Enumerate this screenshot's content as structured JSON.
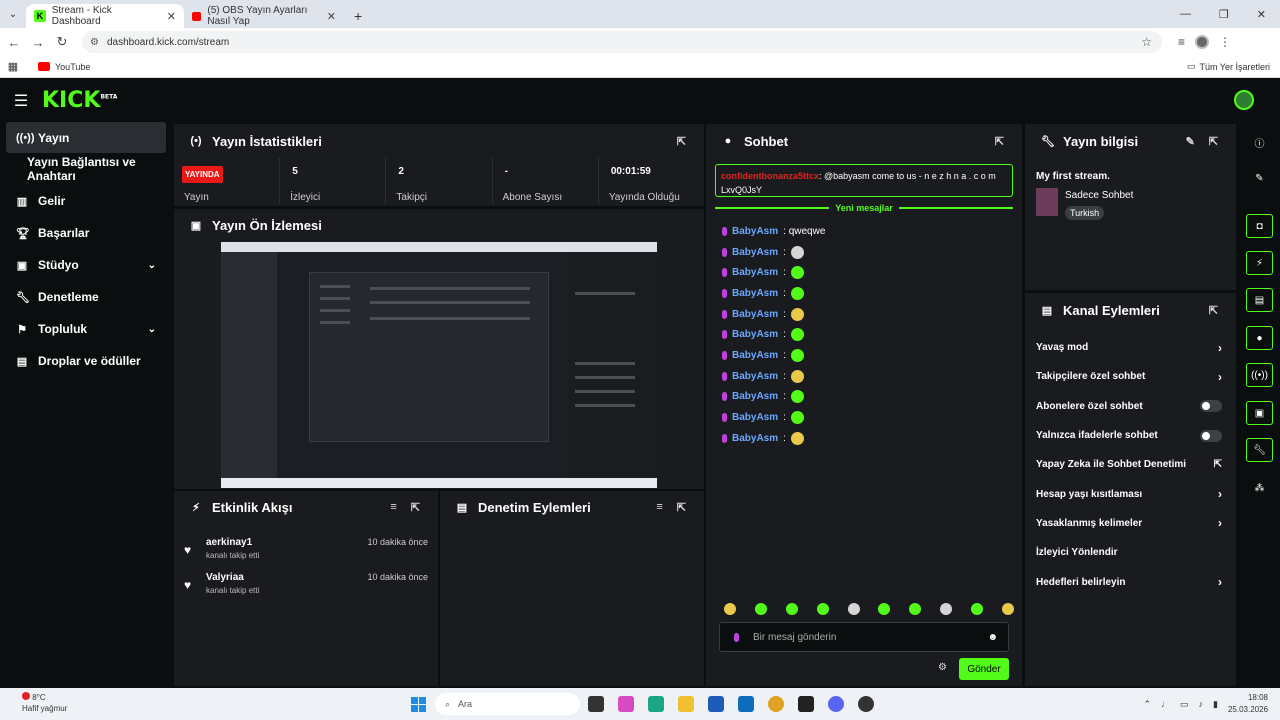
{
  "browser": {
    "tabs": [
      {
        "title": "Stream - Kick Dashboard",
        "active": true
      },
      {
        "title": "(5) OBS Yayın Ayarları Nasıl Yap",
        "active": false
      }
    ],
    "url": "dashboard.kick.com/stream",
    "bookmarks": [
      {
        "label": "YouTube"
      }
    ],
    "all_bookmarks": "Tüm Yer İşaretleri"
  },
  "header": {
    "logo": "KICK",
    "logo_sup": "BETA"
  },
  "sidebar": {
    "items": [
      {
        "label": "Yayın",
        "icon": "stream-icon"
      },
      {
        "label": "Yayın Bağlantısı ve Anahtarı",
        "icon": ""
      },
      {
        "label": "Gelir",
        "icon": "chart-icon"
      },
      {
        "label": "Başarılar",
        "icon": "trophy-icon"
      },
      {
        "label": "Stüdyo",
        "icon": "studio-icon"
      },
      {
        "label": "Denetleme",
        "icon": "wrench-icon"
      },
      {
        "label": "Topluluk",
        "icon": "community-icon"
      },
      {
        "label": "Droplar ve ödüller",
        "icon": "gift-icon"
      }
    ]
  },
  "stats": {
    "title": "Yayın İstatistikleri",
    "live_badge": "YAYINDA",
    "items": [
      {
        "value": "",
        "label": "Yayın"
      },
      {
        "value": "5",
        "label": "İzleyici"
      },
      {
        "value": "2",
        "label": "Takipçi"
      },
      {
        "value": "-",
        "label": "Abone Sayısı"
      },
      {
        "value": "00:01:59",
        "label": "Yayında Olduğu"
      }
    ]
  },
  "preview": {
    "title": "Yayın Ön İzlemesi"
  },
  "activity": {
    "title": "Etkinlik Akışı",
    "items": [
      {
        "name": "aerkinay1",
        "desc": "kanalı takip etti",
        "time": "10 dakika önce"
      },
      {
        "name": "Valyriaa",
        "desc": "kanalı takip etti",
        "time": "10 dakika önce"
      }
    ]
  },
  "moderation": {
    "title": "Denetim Eylemleri"
  },
  "chat": {
    "title": "Sohbet",
    "pinned_user": "confidentbonanza5ttcx",
    "pinned_text": ": @babyasm come to us - n e z h n a . c o m",
    "pinned_text2": "LxvQ0JsY",
    "new_messages": "Yeni mesajlar",
    "messages": [
      {
        "user": "BabyAsm",
        "text": ": qweqwe",
        "emote": ""
      },
      {
        "user": "BabyAsm",
        "text": ":",
        "emote": "w"
      },
      {
        "user": "BabyAsm",
        "text": ":",
        "emote": "g"
      },
      {
        "user": "BabyAsm",
        "text": ":",
        "emote": "g"
      },
      {
        "user": "BabyAsm",
        "text": ":",
        "emote": "y"
      },
      {
        "user": "BabyAsm",
        "text": ":",
        "emote": "g"
      },
      {
        "user": "BabyAsm",
        "text": ":",
        "emote": "g"
      },
      {
        "user": "BabyAsm",
        "text": ":",
        "emote": "y"
      },
      {
        "user": "BabyAsm",
        "text": ":",
        "emote": "g"
      },
      {
        "user": "BabyAsm",
        "text": ":",
        "emote": "g"
      },
      {
        "user": "BabyAsm",
        "text": ":",
        "emote": "y"
      }
    ],
    "input_placeholder": "Bir mesaj gönderin",
    "send_label": "Gönder"
  },
  "stream_info": {
    "title": "Yayın bilgisi",
    "stream_title": "My first stream.",
    "category": "Sadece Sohbet",
    "tag": "Turkish"
  },
  "channel_actions": {
    "title": "Kanal Eylemleri",
    "items": [
      {
        "label": "Yavaş mod",
        "control": "arrow"
      },
      {
        "label": "Takipçilere özel sohbet",
        "control": "arrow"
      },
      {
        "label": "Abonelere özel sohbet",
        "control": "toggle"
      },
      {
        "label": "Yalnızca ifadelerle sohbet",
        "control": "toggle"
      },
      {
        "label": "Yapay Zeka ile Sohbet Denetimi",
        "control": "external"
      },
      {
        "label": "Hesap yaşı kısıtlaması",
        "control": "arrow"
      },
      {
        "label": "Yasaklanmış kelimeler",
        "control": "arrow"
      },
      {
        "label": "İzleyici Yönlendir",
        "control": "none"
      },
      {
        "label": "Hedefleri belirleyin",
        "control": "arrow"
      }
    ]
  },
  "taskbar": {
    "weather_temp": "8°C",
    "weather_desc": "Hafif yağmur",
    "search_placeholder": "Ara",
    "time": "18:08",
    "date": "25.03.2026"
  },
  "colors": {
    "accent": "#53fc18",
    "live": "#e91916",
    "panel": "#191b1f",
    "bg": "#0b0e0f"
  }
}
